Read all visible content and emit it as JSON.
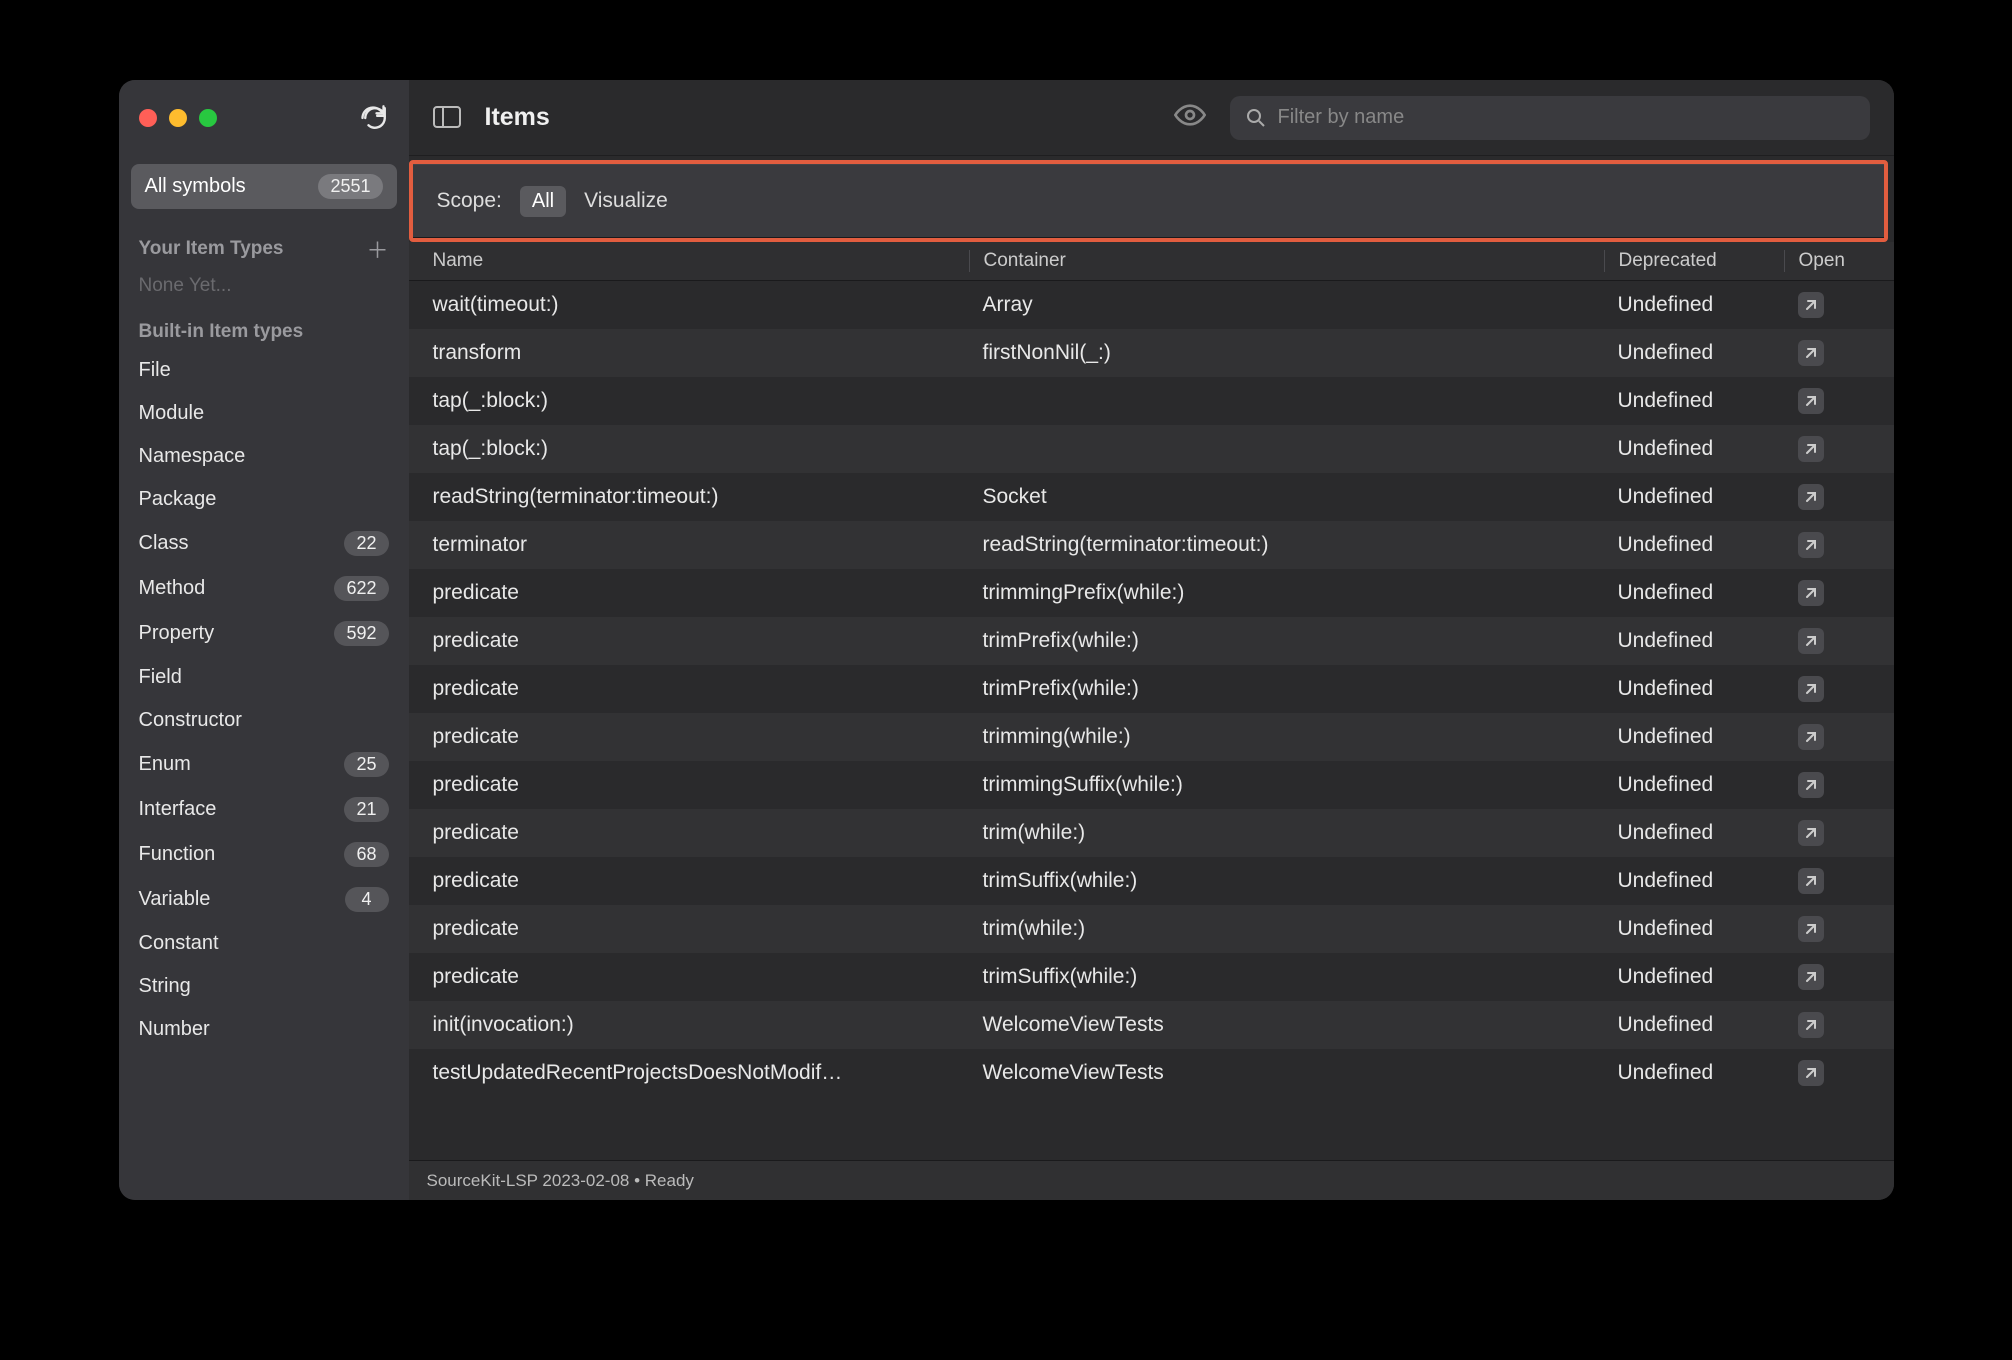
{
  "sidebar": {
    "all_symbols_label": "All symbols",
    "all_symbols_count": "2551",
    "your_item_types_label": "Your Item Types",
    "none_yet_label": "None Yet...",
    "builtin_label": "Built-in Item types",
    "types": [
      {
        "label": "File",
        "count": ""
      },
      {
        "label": "Module",
        "count": ""
      },
      {
        "label": "Namespace",
        "count": ""
      },
      {
        "label": "Package",
        "count": ""
      },
      {
        "label": "Class",
        "count": "22"
      },
      {
        "label": "Method",
        "count": "622"
      },
      {
        "label": "Property",
        "count": "592"
      },
      {
        "label": "Field",
        "count": ""
      },
      {
        "label": "Constructor",
        "count": ""
      },
      {
        "label": "Enum",
        "count": "25"
      },
      {
        "label": "Interface",
        "count": "21"
      },
      {
        "label": "Function",
        "count": "68"
      },
      {
        "label": "Variable",
        "count": "4"
      },
      {
        "label": "Constant",
        "count": ""
      },
      {
        "label": "String",
        "count": ""
      },
      {
        "label": "Number",
        "count": ""
      }
    ]
  },
  "header": {
    "title": "Items",
    "search_placeholder": "Filter by name"
  },
  "scope": {
    "label": "Scope:",
    "chip": "All",
    "visualize": "Visualize"
  },
  "table": {
    "columns": {
      "name": "Name",
      "container": "Container",
      "deprecated": "Deprecated",
      "open": "Open"
    },
    "rows": [
      {
        "name": "wait(timeout:)",
        "container": "Array",
        "deprecated": "Undefined"
      },
      {
        "name": "transform",
        "container": "firstNonNil(_:)",
        "deprecated": "Undefined"
      },
      {
        "name": "tap(_:block:)",
        "container": "",
        "deprecated": "Undefined"
      },
      {
        "name": "tap(_:block:)",
        "container": "",
        "deprecated": "Undefined"
      },
      {
        "name": "readString(terminator:timeout:)",
        "container": "Socket",
        "deprecated": "Undefined"
      },
      {
        "name": "terminator",
        "container": "readString(terminator:timeout:)",
        "deprecated": "Undefined"
      },
      {
        "name": "predicate",
        "container": "trimmingPrefix(while:)",
        "deprecated": "Undefined"
      },
      {
        "name": "predicate",
        "container": "trimPrefix(while:)",
        "deprecated": "Undefined"
      },
      {
        "name": "predicate",
        "container": "trimPrefix(while:)",
        "deprecated": "Undefined"
      },
      {
        "name": "predicate",
        "container": "trimming(while:)",
        "deprecated": "Undefined"
      },
      {
        "name": "predicate",
        "container": "trimmingSuffix(while:)",
        "deprecated": "Undefined"
      },
      {
        "name": "predicate",
        "container": "trim(while:)",
        "deprecated": "Undefined"
      },
      {
        "name": "predicate",
        "container": "trimSuffix(while:)",
        "deprecated": "Undefined"
      },
      {
        "name": "predicate",
        "container": "trim(while:)",
        "deprecated": "Undefined"
      },
      {
        "name": "predicate",
        "container": "trimSuffix(while:)",
        "deprecated": "Undefined"
      },
      {
        "name": "init(invocation:)",
        "container": "WelcomeViewTests",
        "deprecated": "Undefined"
      },
      {
        "name": "testUpdatedRecentProjectsDoesNotModif…",
        "container": "WelcomeViewTests",
        "deprecated": "Undefined"
      }
    ]
  },
  "status": "SourceKit-LSP 2023-02-08 • Ready"
}
